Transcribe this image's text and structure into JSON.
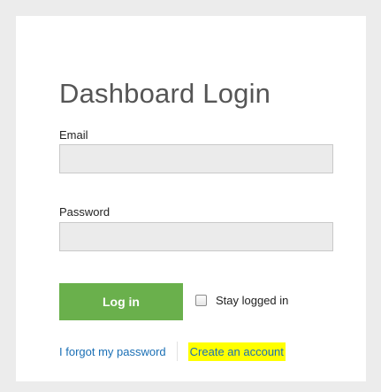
{
  "login": {
    "title": "Dashboard Login",
    "email_label": "Email",
    "email_value": "",
    "password_label": "Password",
    "password_value": "",
    "login_button": "Log in",
    "stay_logged_in_label": "Stay logged in",
    "stay_logged_in_checked": false,
    "forgot_password_link": "I forgot my password",
    "create_account_link": "Create an account"
  },
  "colors": {
    "page_background": "#ececec",
    "card_background": "#ffffff",
    "button_green": "#6ab04c",
    "link_blue": "#1a6fb5",
    "highlight_yellow": "#ffff00"
  }
}
